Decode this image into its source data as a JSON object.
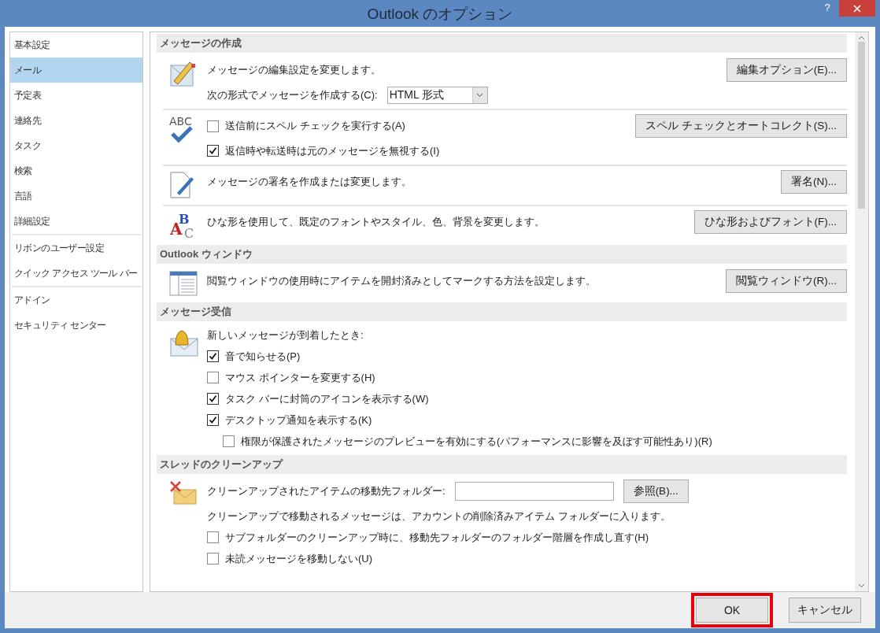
{
  "window": {
    "title": "Outlook のオプション",
    "help": "?"
  },
  "sidebar": {
    "groups": [
      {
        "items": [
          {
            "label": "基本設定",
            "selected": false
          },
          {
            "label": "メール",
            "selected": true
          },
          {
            "label": "予定表",
            "selected": false
          },
          {
            "label": "連絡先",
            "selected": false
          },
          {
            "label": "タスク",
            "selected": false
          },
          {
            "label": "検索",
            "selected": false
          },
          {
            "label": "言語",
            "selected": false
          },
          {
            "label": "詳細設定",
            "selected": false
          }
        ]
      },
      {
        "items": [
          {
            "label": "リボンのユーザー設定",
            "selected": false
          },
          {
            "label": "クイック アクセス ツール バー",
            "selected": false
          }
        ]
      },
      {
        "items": [
          {
            "label": "アドイン",
            "selected": false
          },
          {
            "label": "セキュリティ センター",
            "selected": false
          }
        ]
      }
    ]
  },
  "sections": [
    {
      "title": "メッセージの作成",
      "groups": [
        {
          "rows": [
            {
              "kind": "text",
              "text": "メッセージの編集設定を変更します。",
              "button": "編集オプション(E)..."
            },
            {
              "kind": "select",
              "label": "次の形式でメッセージを作成する(C):",
              "value": "HTML 形式"
            }
          ]
        },
        {
          "icon_text": "ABC",
          "rows": [
            {
              "kind": "check",
              "label": "送信前にスペル チェックを実行する(A)",
              "checked": false,
              "button": "スペル チェックとオートコレクト(S)..."
            },
            {
              "kind": "check",
              "label": "返信時や転送時は元のメッセージを無視する(I)",
              "checked": true
            }
          ]
        },
        {
          "rows": [
            {
              "kind": "text",
              "text": "メッセージの署名を作成または変更します。",
              "button": "署名(N)..."
            }
          ]
        },
        {
          "icon_letters": [
            "B",
            "A",
            "C"
          ],
          "rows": [
            {
              "kind": "text",
              "text": "ひな形を使用して、既定のフォントやスタイル、色、背景を変更します。",
              "button": "ひな形およびフォント(F)..."
            }
          ]
        }
      ]
    },
    {
      "title": "Outlook ウィンドウ",
      "groups": [
        {
          "rows": [
            {
              "kind": "text",
              "text": "閲覧ウィンドウの使用時にアイテムを開封済みとしてマークする方法を設定します。",
              "button": "閲覧ウィンドウ(R)..."
            }
          ]
        }
      ]
    },
    {
      "title": "メッセージ受信",
      "groups": [
        {
          "rows": [
            {
              "kind": "text",
              "text": "新しいメッセージが到着したとき:"
            },
            {
              "kind": "check",
              "label": "音で知らせる(P)",
              "checked": true
            },
            {
              "kind": "check",
              "label": "マウス ポインターを変更する(H)",
              "checked": false
            },
            {
              "kind": "check",
              "label": "タスク バーに封筒のアイコンを表示する(W)",
              "checked": true
            },
            {
              "kind": "check",
              "label": "デスクトップ通知を表示する(K)",
              "checked": true,
              "children": [
                {
                  "kind": "check",
                  "label": "権限が保護されたメッセージのプレビューを有効にする(パフォーマンスに影響を及ぼす可能性あり)(R)",
                  "checked": false
                }
              ]
            }
          ]
        }
      ]
    },
    {
      "title": "スレッドのクリーンアップ",
      "groups": [
        {
          "rows": [
            {
              "kind": "field",
              "label": "クリーンアップされたアイテムの移動先フォルダー:",
              "button": "参照(B)..."
            },
            {
              "kind": "text",
              "text": "クリーンアップで移動されるメッセージは、アカウントの削除済みアイテム フォルダーに入ります。"
            },
            {
              "kind": "check",
              "label": "サブフォルダーのクリーンアップ時に、移動先フォルダーのフォルダー階層を作成し直す(H)",
              "checked": false
            },
            {
              "kind": "check",
              "label": "未読メッセージを移動しない(U)",
              "checked": false
            }
          ]
        }
      ]
    }
  ],
  "buttons": [
    {
      "label": "OK",
      "highlighted": true
    },
    {
      "label": "キャンセル",
      "highlighted": false
    }
  ]
}
